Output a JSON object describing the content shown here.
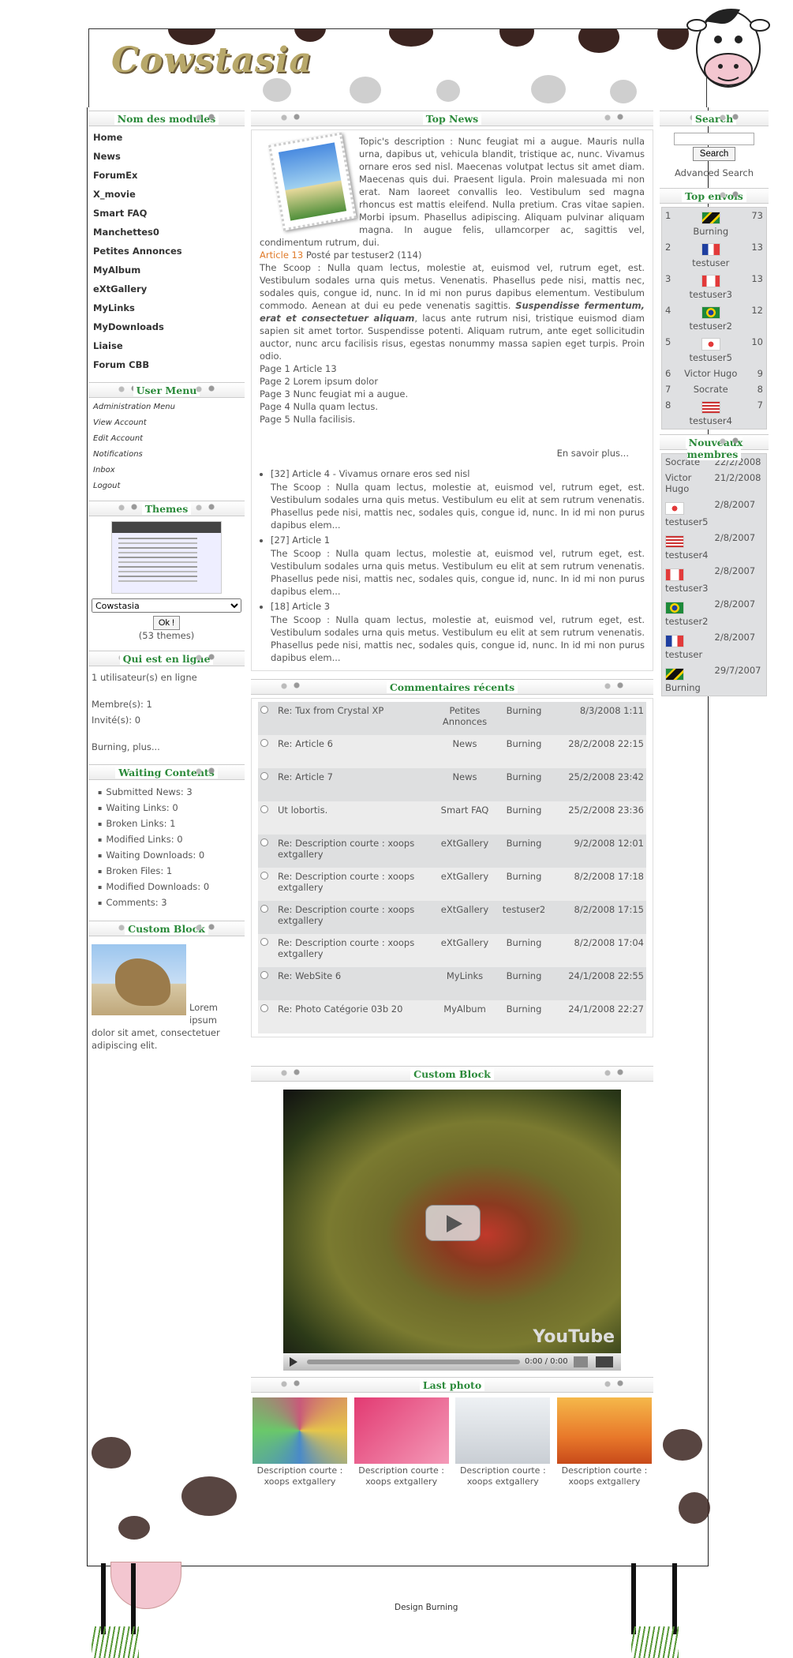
{
  "site": {
    "logo": "Cowstasia",
    "footer_credit": "Design Burning"
  },
  "left": {
    "modules_title": "Nom des modules",
    "modules": [
      "Home",
      "News",
      "ForumEx",
      "X_movie",
      "Smart FAQ",
      "Manchettes0",
      "Petites Annonces",
      "MyAlbum",
      "eXtGallery",
      "MyLinks",
      "MyDownloads",
      "Liaise",
      "Forum CBB"
    ],
    "user_menu_title": "User Menu",
    "user_menu": [
      "Administration Menu",
      "View Account",
      "Edit Account",
      "Notifications",
      "Inbox",
      "Logout"
    ],
    "themes_title": "Themes",
    "theme_selected": "Cowstasia",
    "theme_ok": "Ok !",
    "theme_count": "(53 themes)",
    "online_title": "Qui est en ligne",
    "online_count": "1 utilisateur(s) en ligne",
    "members": "Membre(s): 1",
    "guests": "Invité(s): 0",
    "online_more": "Burning, plus...",
    "waiting_title": "Waiting Contents",
    "waiting": [
      "Submitted News: 3",
      "Waiting Links: 0",
      "Broken Links: 1",
      "Modified Links: 0",
      "Waiting Downloads: 0",
      "Broken Files: 1",
      "Modified Downloads: 0",
      "Comments: 3"
    ],
    "custom_title": "Custom Block",
    "custom_text": "Lorem ipsum dolor sit amet, consectetuer adipiscing elit."
  },
  "center": {
    "top_news_title": "Top News",
    "topic_desc": "Topic's description : Nunc feugiat mi a augue. Mauris nulla urna, dapibus ut, vehicula blandit, tristique ac, nunc. Vivamus ornare eros sed nisl. Maecenas volutpat lectus sit amet diam. Maecenas quis dui. Praesent ligula. Proin malesuada mi non erat. Nam laoreet convallis leo. Vestibulum sed magna rhoncus est mattis eleifend. Nulla pretium. Cras vitae sapien. Morbi ipsum. Phasellus adipiscing. Aliquam pulvinar aliquam magna. In augue felis, ullamcorper ac, sagittis vel, condimentum rutrum, dui.",
    "article_link": "Article 13",
    "article_meta": " Posté par testuser2 (114)",
    "scoop_a": "The Scoop : Nulla quam lectus, molestie at, euismod vel, rutrum eget, est. Vestibulum sodales urna quis metus. Venenatis. Phasellus pede nisi, mattis nec, sodales quis, congue id, nunc. In id mi non purus dapibus elementum. Vestibulum commodo. Aenean at dui eu pede venenatis sagittis. ",
    "scoop_em": "Suspendisse fermentum, erat et consectetuer aliquam",
    "scoop_b": ", lacus ante rutrum nisi, tristique euismod diam sapien sit amet tortor. Suspendisse potenti. Aliquam rutrum, ante eget sollicitudin auctor, nunc arcu facilisis risus, egestas nonummy massa sapien eget turpis. Proin odio.",
    "pages": [
      "Page 1 Article 13",
      "Page 2 Lorem ipsum dolor",
      "Page 3 Nunc feugiat mi a augue.",
      "Page 4 Nulla quam lectus.",
      "Page 5 Nulla facilisis."
    ],
    "read_more": "En savoir plus...",
    "articles": [
      {
        "title": "[32] Article 4 - Vivamus ornare eros sed nisl",
        "text": "The Scoop : Nulla quam lectus, molestie at, euismod vel, rutrum eget, est. Vestibulum sodales urna quis metus. Vestibulum eu elit at sem rutrum venenatis. Phasellus pede nisi, mattis nec, sodales quis, congue id, nunc. In id mi non purus dapibus elem..."
      },
      {
        "title": "[27] Article 1",
        "text": "The Scoop : Nulla quam lectus, molestie at, euismod vel, rutrum eget, est. Vestibulum sodales urna quis metus. Vestibulum eu elit at sem rutrum venenatis. Phasellus pede nisi, mattis nec, sodales quis, congue id, nunc. In id mi non purus dapibus elem..."
      },
      {
        "title": "[18] Article 3",
        "text": "The Scoop : Nulla quam lectus, molestie at, euismod vel, rutrum eget, est. Vestibulum sodales urna quis metus. Vestibulum eu elit at sem rutrum venenatis. Phasellus pede nisi, mattis nec, sodales quis, congue id, nunc. In id mi non purus dapibus elem..."
      }
    ],
    "comments_title": "Commentaires récents",
    "comments": [
      {
        "subject": "Re: Tux from Crystal XP",
        "module": "Petites Annonces",
        "user": "Burning",
        "date": "8/3/2008 1:11"
      },
      {
        "subject": "Re: Article 6",
        "module": "News",
        "user": "Burning",
        "date": "28/2/2008 22:15"
      },
      {
        "subject": "Re: Article 7",
        "module": "News",
        "user": "Burning",
        "date": "25/2/2008 23:42"
      },
      {
        "subject": "Ut lobortis.",
        "module": "Smart FAQ",
        "user": "Burning",
        "date": "25/2/2008 23:36"
      },
      {
        "subject": "Re: Description courte : xoops extgallery",
        "module": "eXtGallery",
        "user": "Burning",
        "date": "9/2/2008 12:01"
      },
      {
        "subject": "Re: Description courte : xoops extgallery",
        "module": "eXtGallery",
        "user": "Burning",
        "date": "8/2/2008 17:18"
      },
      {
        "subject": "Re: Description courte : xoops extgallery",
        "module": "eXtGallery",
        "user": "testuser2",
        "date": "8/2/2008 17:15"
      },
      {
        "subject": "Re: Description courte : xoops extgallery",
        "module": "eXtGallery",
        "user": "Burning",
        "date": "8/2/2008 17:04"
      },
      {
        "subject": "Re: WebSite 6",
        "module": "MyLinks",
        "user": "Burning",
        "date": "24/1/2008 22:55"
      },
      {
        "subject": "Re: Photo Catégorie 03b 20",
        "module": "MyAlbum",
        "user": "Burning",
        "date": "24/1/2008 22:27"
      }
    ],
    "custom_title": "Custom Block",
    "video_time": "0:00 / 0:00",
    "video_logo": "YouTube",
    "last_photo_title": "Last photo",
    "photos": [
      {
        "caption": "Description courte : xoops extgallery",
        "color": "#c85a7a"
      },
      {
        "caption": "Description courte : xoops extgallery",
        "color": "#e23a72"
      },
      {
        "caption": "Description courte : xoops extgallery",
        "color": "#d8dde2"
      },
      {
        "caption": "Description courte : xoops extgallery",
        "color": "#e8782a"
      }
    ]
  },
  "right": {
    "search_title": "Search",
    "search_btn": "Search",
    "advanced": "Advanced Search",
    "top_title": "Top envois",
    "top": [
      {
        "rank": "1",
        "user": "Burning",
        "count": "73",
        "flag": "jm"
      },
      {
        "rank": "2",
        "user": "testuser",
        "count": "13",
        "flag": "fr"
      },
      {
        "rank": "3",
        "user": "testuser3",
        "count": "13",
        "flag": "ca"
      },
      {
        "rank": "4",
        "user": "testuser2",
        "count": "12",
        "flag": "br"
      },
      {
        "rank": "5",
        "user": "testuser5",
        "count": "10",
        "flag": "kr"
      },
      {
        "rank": "6",
        "user": "Victor Hugo",
        "count": "9",
        "flag": ""
      },
      {
        "rank": "7",
        "user": "Socrate",
        "count": "8",
        "flag": ""
      },
      {
        "rank": "8",
        "user": "testuser4",
        "count": "7",
        "flag": "us"
      }
    ],
    "new_title": "Nouveaux membres",
    "new": [
      {
        "user": "Socrate",
        "date": "22/2/2008",
        "flag": ""
      },
      {
        "user": "Victor Hugo",
        "date": "21/2/2008",
        "flag": ""
      },
      {
        "user": "testuser5",
        "date": "2/8/2007",
        "flag": "kr"
      },
      {
        "user": "testuser4",
        "date": "2/8/2007",
        "flag": "us"
      },
      {
        "user": "testuser3",
        "date": "2/8/2007",
        "flag": "ca"
      },
      {
        "user": "testuser2",
        "date": "2/8/2007",
        "flag": "br"
      },
      {
        "user": "testuser",
        "date": "2/8/2007",
        "flag": "fr"
      },
      {
        "user": "Burning",
        "date": "29/7/2007",
        "flag": "jm"
      }
    ]
  }
}
